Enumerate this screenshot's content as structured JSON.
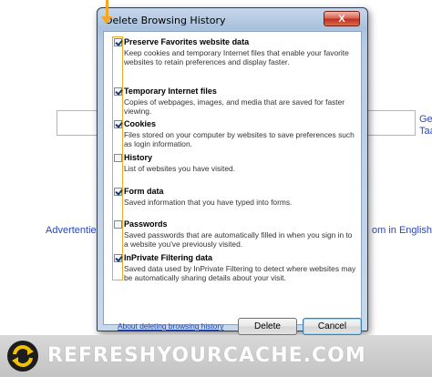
{
  "background": {
    "top_right_links": [
      "Gea",
      "Taa"
    ],
    "left_link": "Advertentiep",
    "right_link": "om in English"
  },
  "dialog": {
    "title": "Delete Browsing History",
    "close_label": "X",
    "items": [
      {
        "label": "Preserve Favorites website data",
        "checked": true,
        "description": "Keep cookies and temporary Internet files that enable your favorite websites to retain preferences and display faster."
      },
      {
        "label": "Temporary Internet files",
        "checked": true,
        "description": "Copies of webpages, images, and media that are saved for faster viewing."
      },
      {
        "label": "Cookies",
        "checked": true,
        "description": "Files stored on your computer by websites to save preferences such as login information."
      },
      {
        "label": "History",
        "checked": false,
        "description": "List of websites you have visited."
      },
      {
        "label": "Form data",
        "checked": true,
        "description": "Saved information that you have typed into forms."
      },
      {
        "label": "Passwords",
        "checked": false,
        "description": "Saved passwords that are automatically filled in when you sign in to a website you've previously visited."
      },
      {
        "label": "InPrivate Filtering data",
        "checked": true,
        "description": "Saved data used by InPrivate Filtering to detect where websites may be automatically sharing details about your visit."
      }
    ],
    "about_link": "About deleting browsing history",
    "delete_label": "Delete",
    "cancel_label": "Cancel"
  },
  "colors": {
    "highlight": "#f5a623",
    "link": "#2244aa"
  },
  "footer": {
    "brand": "REFRESHYOURCACHE.COM",
    "logo_icon": "refresh-arrows-icon"
  }
}
